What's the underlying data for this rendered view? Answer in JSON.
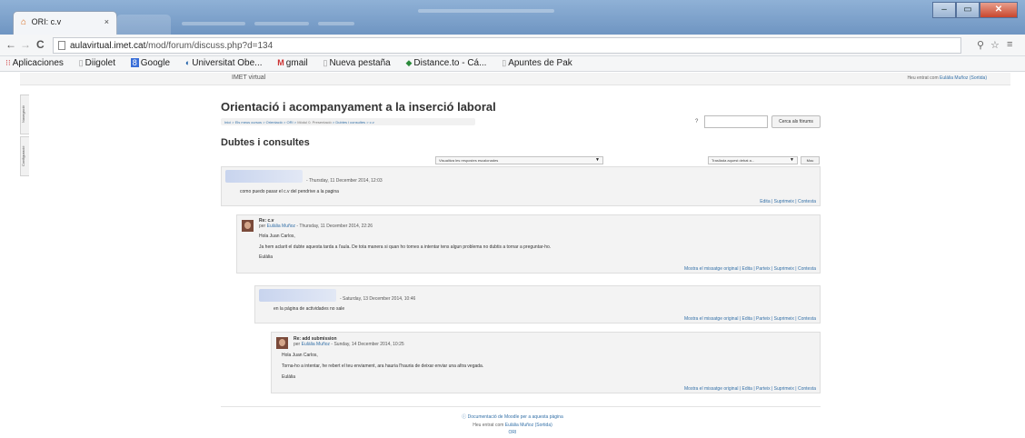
{
  "browser": {
    "tab_title": "ORI: c.v",
    "tab_close": "×",
    "url_host": "aulavirtual.imet.cat",
    "url_path": "/mod/forum/discuss.php?d=134",
    "bookmarks": [
      {
        "icon": "apps-icon",
        "label": "Aplicaciones"
      },
      {
        "icon": "page-icon",
        "label": "Diigolet"
      },
      {
        "icon": "google-icon",
        "label": "Google"
      },
      {
        "icon": "uoc-icon",
        "label": "Universitat Obe..."
      },
      {
        "icon": "gmail-icon",
        "label": "gmail"
      },
      {
        "icon": "page-icon",
        "label": "Nueva pestaña"
      },
      {
        "icon": "distance-icon",
        "label": "Distance.to - Cá..."
      },
      {
        "icon": "page-icon",
        "label": "Apuntes de Pak"
      }
    ]
  },
  "site": {
    "brand": "IMET virtual",
    "login_prefix": "Heu entrat com",
    "login_user": "Eulàlia Muñoz",
    "login_logout": "(Sortida)",
    "side_tabs": [
      "Navegació",
      "Configuració"
    ]
  },
  "course": {
    "title": "Orientació i acompanyament a la inserció laboral",
    "breadcrumb": [
      "Inici",
      "Els meus cursos",
      "Orientació",
      "ORI",
      "Mòdul 0. Presentació",
      "Dubtes i consultes",
      "c.v"
    ],
    "breadcrumb_sep": ">",
    "search_button": "Cerca als fòrums",
    "help_icon": "?"
  },
  "discussion": {
    "title": "Dubtes i consultes",
    "display_mode": "Visualitza les respostes escalonades",
    "move_to": "Trasllada aquest debat a...",
    "move_button": "Mou",
    "posts": [
      {
        "subject": "",
        "author": "",
        "date": "- Thursday, 11 December 2014, 12:03",
        "body": [
          "como puedo pasar el c.v del pendrive a la pagina"
        ],
        "actions": "Edita | Suprimeix | Contesta"
      },
      {
        "subject": "Re: c.v",
        "author_prefix": "per",
        "author": "Eulàlia Muñoz",
        "date": "- Thursday, 11 December 2014, 22:26",
        "body": [
          "Hola Juan Carlos,",
          "Ja hem aclarit el dubte aquesta tarda a l'aula. De tota manera si quan ho tornes a intentar tens algun problema no dubtis a tornar a preguntar-ho.",
          "Eulàlia"
        ],
        "actions": "Mostra el missatge original | Edita | Parteix | Suprimeix | Contesta"
      },
      {
        "subject": "",
        "author": "",
        "date": "- Saturday, 13 December 2014, 10:46",
        "body": [
          "en la página de actividades no sale"
        ],
        "actions": "Mostra el missatge original | Edita | Parteix | Suprimeix | Contesta"
      },
      {
        "subject": "Re: add submission",
        "author_prefix": "per",
        "author": "Eulàlia Muñoz",
        "date": "- Sunday, 14 December 2014, 10:25",
        "body": [
          "Hola Juan Carlos,",
          "Torna-ho a intentar, he rebert el teu enviament, ara hauria l'hauria de deixar enviar una altra vegada.",
          "Eulàlia"
        ],
        "actions": "Mostra el missatge original | Edita | Parteix | Suprimeix | Contesta"
      }
    ]
  },
  "footer": {
    "doc_link": "Documentació de Moodle per a aquesta pàgina",
    "login_prefix": "Heu entrat com",
    "login_user": "Eulàlia Muñoz",
    "login_logout": "(Sortida)",
    "course_link": "ORI"
  }
}
